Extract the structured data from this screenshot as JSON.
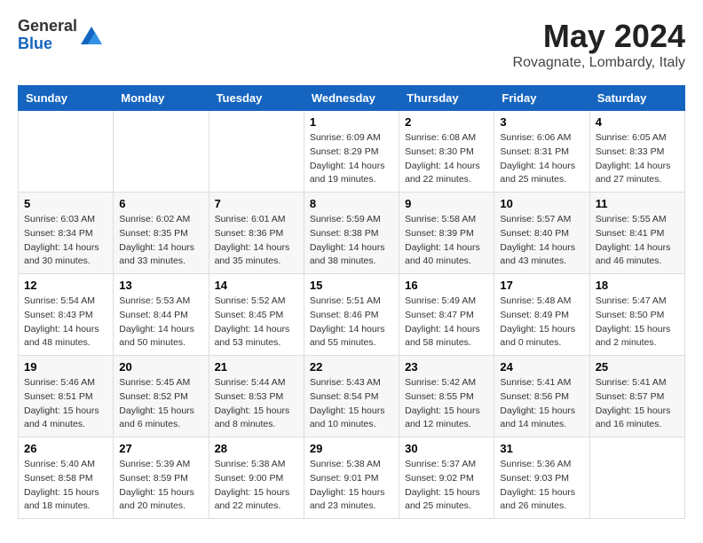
{
  "header": {
    "logo_general": "General",
    "logo_blue": "Blue",
    "month": "May 2024",
    "location": "Rovagnate, Lombardy, Italy"
  },
  "weekdays": [
    "Sunday",
    "Monday",
    "Tuesday",
    "Wednesday",
    "Thursday",
    "Friday",
    "Saturday"
  ],
  "weeks": [
    [
      {
        "day": "",
        "details": []
      },
      {
        "day": "",
        "details": []
      },
      {
        "day": "",
        "details": []
      },
      {
        "day": "1",
        "details": [
          "Sunrise: 6:09 AM",
          "Sunset: 8:29 PM",
          "Daylight: 14 hours",
          "and 19 minutes."
        ]
      },
      {
        "day": "2",
        "details": [
          "Sunrise: 6:08 AM",
          "Sunset: 8:30 PM",
          "Daylight: 14 hours",
          "and 22 minutes."
        ]
      },
      {
        "day": "3",
        "details": [
          "Sunrise: 6:06 AM",
          "Sunset: 8:31 PM",
          "Daylight: 14 hours",
          "and 25 minutes."
        ]
      },
      {
        "day": "4",
        "details": [
          "Sunrise: 6:05 AM",
          "Sunset: 8:33 PM",
          "Daylight: 14 hours",
          "and 27 minutes."
        ]
      }
    ],
    [
      {
        "day": "5",
        "details": [
          "Sunrise: 6:03 AM",
          "Sunset: 8:34 PM",
          "Daylight: 14 hours",
          "and 30 minutes."
        ]
      },
      {
        "day": "6",
        "details": [
          "Sunrise: 6:02 AM",
          "Sunset: 8:35 PM",
          "Daylight: 14 hours",
          "and 33 minutes."
        ]
      },
      {
        "day": "7",
        "details": [
          "Sunrise: 6:01 AM",
          "Sunset: 8:36 PM",
          "Daylight: 14 hours",
          "and 35 minutes."
        ]
      },
      {
        "day": "8",
        "details": [
          "Sunrise: 5:59 AM",
          "Sunset: 8:38 PM",
          "Daylight: 14 hours",
          "and 38 minutes."
        ]
      },
      {
        "day": "9",
        "details": [
          "Sunrise: 5:58 AM",
          "Sunset: 8:39 PM",
          "Daylight: 14 hours",
          "and 40 minutes."
        ]
      },
      {
        "day": "10",
        "details": [
          "Sunrise: 5:57 AM",
          "Sunset: 8:40 PM",
          "Daylight: 14 hours",
          "and 43 minutes."
        ]
      },
      {
        "day": "11",
        "details": [
          "Sunrise: 5:55 AM",
          "Sunset: 8:41 PM",
          "Daylight: 14 hours",
          "and 46 minutes."
        ]
      }
    ],
    [
      {
        "day": "12",
        "details": [
          "Sunrise: 5:54 AM",
          "Sunset: 8:43 PM",
          "Daylight: 14 hours",
          "and 48 minutes."
        ]
      },
      {
        "day": "13",
        "details": [
          "Sunrise: 5:53 AM",
          "Sunset: 8:44 PM",
          "Daylight: 14 hours",
          "and 50 minutes."
        ]
      },
      {
        "day": "14",
        "details": [
          "Sunrise: 5:52 AM",
          "Sunset: 8:45 PM",
          "Daylight: 14 hours",
          "and 53 minutes."
        ]
      },
      {
        "day": "15",
        "details": [
          "Sunrise: 5:51 AM",
          "Sunset: 8:46 PM",
          "Daylight: 14 hours",
          "and 55 minutes."
        ]
      },
      {
        "day": "16",
        "details": [
          "Sunrise: 5:49 AM",
          "Sunset: 8:47 PM",
          "Daylight: 14 hours",
          "and 58 minutes."
        ]
      },
      {
        "day": "17",
        "details": [
          "Sunrise: 5:48 AM",
          "Sunset: 8:49 PM",
          "Daylight: 15 hours",
          "and 0 minutes."
        ]
      },
      {
        "day": "18",
        "details": [
          "Sunrise: 5:47 AM",
          "Sunset: 8:50 PM",
          "Daylight: 15 hours",
          "and 2 minutes."
        ]
      }
    ],
    [
      {
        "day": "19",
        "details": [
          "Sunrise: 5:46 AM",
          "Sunset: 8:51 PM",
          "Daylight: 15 hours",
          "and 4 minutes."
        ]
      },
      {
        "day": "20",
        "details": [
          "Sunrise: 5:45 AM",
          "Sunset: 8:52 PM",
          "Daylight: 15 hours",
          "and 6 minutes."
        ]
      },
      {
        "day": "21",
        "details": [
          "Sunrise: 5:44 AM",
          "Sunset: 8:53 PM",
          "Daylight: 15 hours",
          "and 8 minutes."
        ]
      },
      {
        "day": "22",
        "details": [
          "Sunrise: 5:43 AM",
          "Sunset: 8:54 PM",
          "Daylight: 15 hours",
          "and 10 minutes."
        ]
      },
      {
        "day": "23",
        "details": [
          "Sunrise: 5:42 AM",
          "Sunset: 8:55 PM",
          "Daylight: 15 hours",
          "and 12 minutes."
        ]
      },
      {
        "day": "24",
        "details": [
          "Sunrise: 5:41 AM",
          "Sunset: 8:56 PM",
          "Daylight: 15 hours",
          "and 14 minutes."
        ]
      },
      {
        "day": "25",
        "details": [
          "Sunrise: 5:41 AM",
          "Sunset: 8:57 PM",
          "Daylight: 15 hours",
          "and 16 minutes."
        ]
      }
    ],
    [
      {
        "day": "26",
        "details": [
          "Sunrise: 5:40 AM",
          "Sunset: 8:58 PM",
          "Daylight: 15 hours",
          "and 18 minutes."
        ]
      },
      {
        "day": "27",
        "details": [
          "Sunrise: 5:39 AM",
          "Sunset: 8:59 PM",
          "Daylight: 15 hours",
          "and 20 minutes."
        ]
      },
      {
        "day": "28",
        "details": [
          "Sunrise: 5:38 AM",
          "Sunset: 9:00 PM",
          "Daylight: 15 hours",
          "and 22 minutes."
        ]
      },
      {
        "day": "29",
        "details": [
          "Sunrise: 5:38 AM",
          "Sunset: 9:01 PM",
          "Daylight: 15 hours",
          "and 23 minutes."
        ]
      },
      {
        "day": "30",
        "details": [
          "Sunrise: 5:37 AM",
          "Sunset: 9:02 PM",
          "Daylight: 15 hours",
          "and 25 minutes."
        ]
      },
      {
        "day": "31",
        "details": [
          "Sunrise: 5:36 AM",
          "Sunset: 9:03 PM",
          "Daylight: 15 hours",
          "and 26 minutes."
        ]
      },
      {
        "day": "",
        "details": []
      }
    ]
  ]
}
